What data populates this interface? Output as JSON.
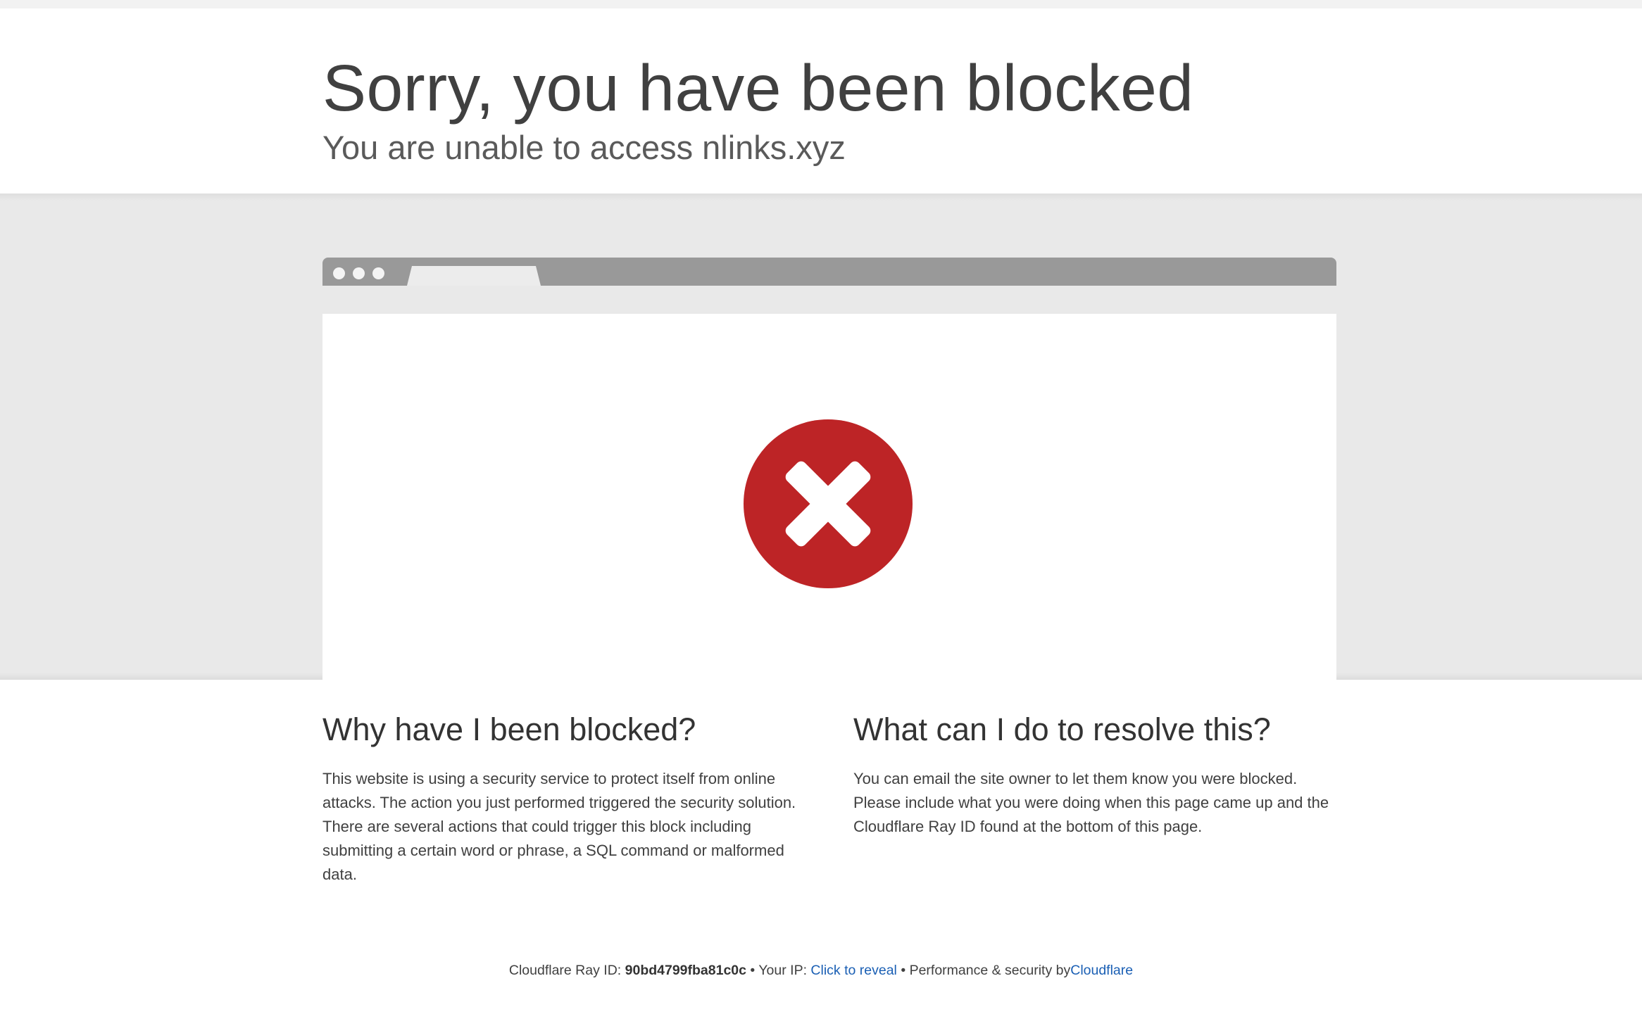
{
  "header": {
    "title": "Sorry, you have been blocked",
    "subtitle": "You are unable to access nlinks.xyz"
  },
  "browser_illustration": {
    "icon": "error-x-icon",
    "icon_color": "#bd2426"
  },
  "why_blocked": {
    "heading": "Why have I been blocked?",
    "body": "This website is using a security service to protect itself from online attacks. The action you just performed triggered the security solution. There are several actions that could trigger this block including submitting a certain word or phrase, a SQL command or malformed data."
  },
  "resolve": {
    "heading": "What can I do to resolve this?",
    "body": "You can email the site owner to let them know you were blocked. Please include what you were doing when this page came up and the Cloudflare Ray ID found at the bottom of this page."
  },
  "footer": {
    "ray_label": "Cloudflare Ray ID:",
    "ray_id": "90bd4799fba81c0c",
    "separator": "•",
    "ip_label": "Your IP:",
    "ip_link": "Click to reveal",
    "perf_label": "Performance & security by",
    "cloudflare_link": "Cloudflare"
  },
  "colors": {
    "link": "#1a5fb4",
    "band": "#e9e9e9",
    "frame": "#999999"
  }
}
